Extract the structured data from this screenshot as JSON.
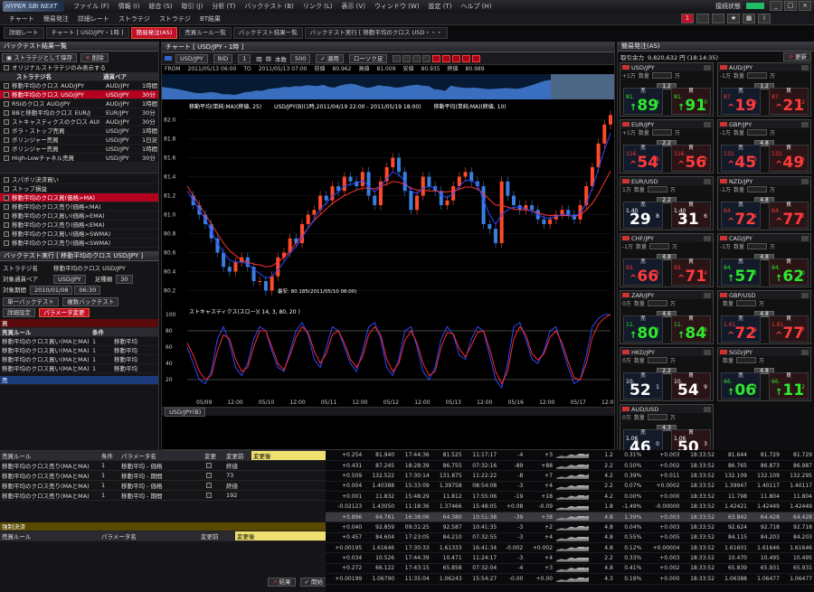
{
  "app": {
    "logo_text": "HYPER SBI NEXT",
    "menu": [
      "ファイル (F)",
      "情報 (I)",
      "総合 (S)",
      "取引 (J)",
      "分析 (T)",
      "バックテスト (B)",
      "リンク (L)",
      "表示 (V)",
      "ウィンドウ (W)",
      "設定 (T)",
      "ヘルプ (H)"
    ],
    "status_label": "接続状態",
    "page_number": "1"
  },
  "toolbar": [
    "チャート",
    "簡易発注",
    "詳細レート",
    "ストラテジ",
    "ストラテジ",
    "BT結果"
  ],
  "tabs": [
    {
      "label": "詳細レート",
      "active": false
    },
    {
      "label": "チャート [ USD/JPY・1時 ]",
      "active": false
    },
    {
      "label": "簡易発注(AS)",
      "active": true
    },
    {
      "label": "売買ルール一覧",
      "active": false
    },
    {
      "label": "バックテスト結果一覧",
      "active": false
    },
    {
      "label": "バックテスト実行 [ 移動平均のクロス USD・・・",
      "active": false
    }
  ],
  "left": {
    "title": "バックテスト結果一覧",
    "save_btn": "ストラテジとして保存",
    "delete_btn": "削除",
    "only_original": "オリジナルストラテジのみ表示する",
    "headers": [
      "ストラテジ名",
      "通貨ペア",
      ""
    ],
    "results": [
      {
        "name": "移動平均のクロス AUD/JPY",
        "pair": "AUD/JPY",
        "tf": "1時間",
        "sel": false
      },
      {
        "name": "移動平均のクロス USD/JPY",
        "pair": "USD/JPY",
        "tf": "30分",
        "sel": true
      },
      {
        "name": "RSIのクロス AUD/JPY",
        "pair": "AUD/JPY",
        "tf": "1時間",
        "sel": false
      },
      {
        "name": "BBと移動平均のクロス EUR/J",
        "pair": "EUR/JPY",
        "tf": "30分",
        "sel": false
      },
      {
        "name": "ストキャスティクスのクロス AUI",
        "pair": "AUD/JPY",
        "tf": "30分",
        "sel": false
      },
      {
        "name": "ボラ・ストップ売買",
        "pair": "USD/JPY",
        "tf": "1時間",
        "sel": false
      },
      {
        "name": "ボリンジャー売買",
        "pair": "USD/JPY",
        "tf": "1日足",
        "sel": false
      },
      {
        "name": "ボリンジャー売買",
        "pair": "USD/JPY",
        "tf": "1時間",
        "sel": false
      },
      {
        "name": "High-Lowチャネル売買",
        "pair": "USD/JPY",
        "tf": "30分",
        "sel": false
      }
    ],
    "rules": [
      {
        "name": "スパボリ決済買い",
        "sel": false
      },
      {
        "name": "ストップ損益",
        "sel": false
      },
      {
        "name": "移動平均のクロス買(価格>MA)",
        "sel": true
      },
      {
        "name": "移動平均のクロス売り(価格<MA)",
        "sel": false
      },
      {
        "name": "移動平均のクロス買い(価格>EMA)",
        "sel": false
      },
      {
        "name": "移動平均のクロス売り(価格<EMA)",
        "sel": false
      },
      {
        "name": "移動平均のクロス買い(価格>SWMA)",
        "sel": false
      },
      {
        "name": "移動平均のクロス売り(価格<SWMA)",
        "sel": false
      }
    ],
    "exec_title": "バックテスト実行 [ 移動平均のクロス USD/JPY ]",
    "strategy_label": "ストラテジ名",
    "strategy_value": "移動平均のクロス USD/JPY",
    "pair_label": "対象通貨ペア",
    "pair_value": "USD/JPY",
    "tf_label": "足種類",
    "tf_value": "30",
    "period_label": "対象期間",
    "date_from": "2010/01/08",
    "time_from": "06:30",
    "single_tab": "単一バックテスト",
    "multi_tab": "複数バックテスト",
    "detail_tab": "詳細設定",
    "param_tab": "パラメータ変更",
    "buy_label": "買",
    "rule_headers": [
      "売買ルール",
      "条件",
      ""
    ],
    "buy_rules": [
      {
        "rule": "移動平均のクロス買い(MAとMA)",
        "cond": "1",
        "name": "移動平均"
      },
      {
        "rule": "移動平均のクロス買い(MAとMA)",
        "cond": "1",
        "name": "移動平均"
      },
      {
        "rule": "移動平均のクロス買い(MAとMA)",
        "cond": "1",
        "name": "移動平均"
      },
      {
        "rule": "移動平均のクロス買い(MAとMA)",
        "cond": "1",
        "name": "移動平均"
      }
    ],
    "sell_label": "売"
  },
  "bottomleft": {
    "headers": [
      "売買ルール",
      "条件",
      "パラメータ名",
      "変更",
      "変更前",
      "変更後"
    ],
    "rows": [
      {
        "rule": "移動平均のクロス売り(MAとMA)",
        "cond": "1",
        "param": "移動平均 - 価格",
        "before": "終値"
      },
      {
        "rule": "移動平均のクロス売り(MAとMA)",
        "cond": "1",
        "param": "移動平均 - 期間",
        "before": "73"
      },
      {
        "rule": "移動平均のクロス売り(MAとMA)",
        "cond": "1",
        "param": "移動平均 - 価格",
        "before": "終値"
      },
      {
        "rule": "移動平均のクロス売り(MAとMA)",
        "cond": "1",
        "param": "移動平均 - 期間",
        "before": "192"
      }
    ],
    "forced_label": "強制決済",
    "forced_headers": [
      "売買ルール",
      "パラメータ名",
      "変更前",
      "変更後"
    ],
    "result_btn": "結果",
    "start_btn": "開始"
  },
  "chart": {
    "title": "チャート [ USD/JPY・1時 ]",
    "pair": "USD/JPY",
    "bid": "BID",
    "tf": "1",
    "tf_unit": "時",
    "count_label": "本数",
    "count": "500",
    "apply": "適用",
    "candle": "ローソク足",
    "from_label": "FROM",
    "from": "2011/05/13 06:00",
    "to_label": "TO",
    "to": "2011/05/13 07:00",
    "open_label": "前値",
    "open": "80.962",
    "high_label": "高値",
    "high": "81.009",
    "low_label": "安値",
    "low": "80.935",
    "close_label": "終値",
    "close": "80.989",
    "ma_legend1": "移動平均(単純:MA)(終値, 25)",
    "series_legend": "USD/JPY(B)(1時,2011/04/19 22:00 - 2011/05/19 18:00)",
    "ma_legend2": "移動平均(単純:MA)(終値, 10)",
    "low_marker": "最安: 80.185(2011/05/10 08:00)",
    "stoch_legend": "ストキャスティクス(スロー)( 14, 3, 80, 20 )",
    "footer_tab": "USD/JPY(B)"
  },
  "chart_data": {
    "type": "line",
    "title": "USD/JPY 1時",
    "y_ticks": [
      82.0,
      81.8,
      81.6,
      81.4,
      81.2,
      81.0,
      80.8,
      80.6,
      80.4,
      80.2
    ],
    "ylim": [
      80.1,
      82.1
    ],
    "x_ticks": [
      "05/09",
      "12:00",
      "05/10",
      "12:00",
      "05/11",
      "12:00",
      "05/12",
      "12:00",
      "05/13",
      "12:00",
      "05/16",
      "12:00",
      "05/17",
      "12:00"
    ],
    "price": [
      81.2,
      81.1,
      81.0,
      80.9,
      80.75,
      80.6,
      80.45,
      80.4,
      80.5,
      80.55,
      80.45,
      80.3,
      80.3,
      80.2,
      80.35,
      80.55,
      80.6,
      80.75,
      80.7,
      80.9,
      81.0,
      81.05,
      81.2,
      81.15,
      81.3,
      81.25,
      81.4,
      81.35,
      81.3,
      81.45,
      81.2,
      81.1,
      81.35,
      81.5,
      81.6,
      81.45,
      81.25,
      81.05,
      81.2,
      81.4,
      81.3,
      81.25,
      81.1,
      81.15,
      81.3,
      81.4,
      81.45,
      81.35,
      81.3,
      80.9,
      80.85,
      80.7,
      81.35,
      81.2,
      81.1,
      81.05,
      81.1,
      81.05,
      80.95,
      80.9,
      80.95,
      81.0,
      81.05,
      81.0,
      80.95,
      81.1,
      81.3,
      81.5,
      81.75,
      81.95,
      82.05
    ],
    "ma25": [
      81.3,
      81.2,
      81.1,
      81.0,
      80.9,
      80.8,
      80.7,
      80.62,
      80.57,
      80.52,
      80.5,
      80.48,
      80.47,
      80.45,
      80.46,
      80.5,
      80.55,
      80.62,
      80.7,
      80.78,
      80.86,
      80.94,
      81.0,
      81.06,
      81.12,
      81.16,
      81.2,
      81.23,
      81.26,
      81.28,
      81.28,
      81.27,
      81.3,
      81.32,
      81.35,
      81.34,
      81.32,
      81.28,
      81.26,
      81.26,
      81.25,
      81.25,
      81.24,
      81.24,
      81.25,
      81.27,
      81.29,
      81.29,
      81.27,
      81.22,
      81.16,
      81.1,
      81.1,
      81.08,
      81.06,
      81.05,
      81.05,
      81.04,
      81.02,
      81.0,
      80.99,
      80.99,
      80.99,
      80.99,
      80.98,
      81.0,
      81.05,
      81.12,
      81.22,
      81.34,
      81.46
    ],
    "ma10": [
      81.25,
      81.15,
      81.05,
      80.95,
      80.82,
      80.7,
      80.6,
      80.52,
      80.5,
      80.5,
      80.48,
      80.42,
      80.38,
      80.33,
      80.35,
      80.42,
      80.5,
      80.6,
      80.66,
      80.76,
      80.86,
      80.95,
      81.06,
      81.12,
      81.2,
      81.24,
      81.3,
      81.32,
      81.33,
      81.36,
      81.3,
      81.24,
      81.3,
      81.38,
      81.45,
      81.42,
      81.35,
      81.25,
      81.22,
      81.28,
      81.3,
      81.28,
      81.2,
      81.18,
      81.22,
      81.3,
      81.36,
      81.36,
      81.32,
      81.15,
      81.0,
      80.9,
      81.0,
      81.05,
      81.08,
      81.08,
      81.06,
      81.04,
      81.0,
      80.97,
      80.96,
      80.98,
      81.0,
      81.0,
      80.98,
      81.02,
      81.12,
      81.28,
      81.48,
      81.68,
      81.86
    ],
    "stoch_k": [
      60,
      40,
      20,
      15,
      30,
      70,
      85,
      65,
      35,
      25,
      40,
      70,
      85,
      80,
      55,
      35,
      30,
      55,
      80,
      90,
      75,
      45,
      35,
      60,
      85,
      80,
      60,
      40,
      30,
      55,
      85,
      90,
      70,
      35,
      25,
      45,
      80,
      85,
      60,
      30,
      20,
      35,
      70,
      85,
      75,
      50,
      45,
      70,
      85,
      80,
      50,
      20,
      10,
      40,
      85,
      90,
      70,
      45,
      40,
      55,
      80,
      85,
      60,
      35,
      15,
      20,
      50,
      85,
      95,
      100,
      100
    ],
    "stoch_d": [
      65,
      50,
      30,
      20,
      25,
      55,
      75,
      70,
      45,
      30,
      35,
      60,
      80,
      80,
      60,
      40,
      32,
      50,
      72,
      85,
      78,
      55,
      40,
      52,
      75,
      80,
      65,
      45,
      35,
      48,
      75,
      85,
      75,
      45,
      30,
      40,
      68,
      80,
      65,
      40,
      25,
      30,
      60,
      78,
      76,
      58,
      48,
      62,
      78,
      80,
      58,
      30,
      15,
      30,
      70,
      85,
      75,
      52,
      44,
      52,
      72,
      80,
      65,
      42,
      22,
      20,
      40,
      72,
      88,
      96,
      100
    ],
    "stoch_ylim": [
      0,
      100
    ],
    "stoch_lines": [
      80,
      20
    ]
  },
  "right": {
    "title": "簡易発注(AS)",
    "balance_label": "取引余力",
    "balance": "9,820,632 円 (18:14:35)",
    "refresh": "更新",
    "qty_label": "数量",
    "unit": "万",
    "sell": "売",
    "buy": "買",
    "quotes": [
      {
        "pair": "USD/JPY",
        "step": "+1万",
        "spread": "1.2",
        "sell_sm": "81.",
        "sell_big": "89",
        "sell_sup": "8",
        "buy_sm": "81.",
        "buy_big": "91",
        "buy_sup": "0",
        "dir_s": "up",
        "dir_b": "up",
        "arrow_s": "↑",
        "arrow_b": "↑"
      },
      {
        "pair": "AUD/JPY",
        "step": "-1万",
        "spread": "1.2",
        "sell_sm": "87.",
        "sell_big": "19",
        "sell_sup": "6",
        "buy_sm": "87.",
        "buy_big": "21",
        "buy_sup": "2",
        "dir_s": "dn",
        "dir_b": "dn",
        "arrow_s": "^",
        "arrow_b": "^"
      },
      {
        "pair": "EUR/JPY",
        "step": "+1万",
        "spread": "2.2",
        "sell_sm": "116.",
        "sell_big": "54",
        "sell_sup": "6",
        "buy_sm": "116.",
        "buy_big": "56",
        "buy_sup": "8",
        "dir_s": "dn",
        "dir_b": "dn",
        "arrow_s": "^",
        "arrow_b": "^"
      },
      {
        "pair": "GBP/JPY",
        "step": "-1万",
        "spread": "4.8",
        "sell_sm": "132.",
        "sell_big": "45",
        "sell_sup": "8",
        "buy_sm": "132.",
        "buy_big": "49",
        "buy_sup": "6",
        "dir_s": "dn",
        "dir_b": "dn",
        "arrow_s": "^",
        "arrow_b": "^"
      },
      {
        "pair": "EUR/USD",
        "step": "1万",
        "spread": "2.2",
        "sell_sm": "1.40",
        "sell_big": "29",
        "sell_sup": "8",
        "buy_sm": "1.40",
        "buy_big": "31",
        "buy_sup": "6",
        "dir_s": "wh",
        "dir_b": "wh",
        "arrow_s": "",
        "arrow_b": ""
      },
      {
        "pair": "NZD/JPY",
        "step": "-1万",
        "spread": "4.8",
        "sell_sm": "64.",
        "sell_big": "72",
        "sell_sup": "4",
        "buy_sm": "64.",
        "buy_big": "77",
        "buy_sup": "2",
        "dir_s": "dn",
        "dir_b": "dn",
        "arrow_s": "^",
        "arrow_b": "^"
      },
      {
        "pair": "CHF/JPY",
        "step": "-1万",
        "spread": "4.8",
        "sell_sm": "92.",
        "sell_big": "66",
        "sell_sup": "6",
        "buy_sm": "92.",
        "buy_big": "71",
        "buy_sup": "4",
        "dir_s": "dn",
        "dir_b": "dn",
        "arrow_s": "^",
        "arrow_b": "^"
      },
      {
        "pair": "CAD/JPY",
        "step": "-1万",
        "spread": "4.8",
        "sell_sm": "84.",
        "sell_big": "57",
        "sell_sup": "2",
        "buy_sm": "84.",
        "buy_big": "62",
        "buy_sup": "0",
        "dir_s": "up",
        "dir_b": "up",
        "arrow_s": "↑",
        "arrow_b": "↑"
      },
      {
        "pair": "ZAR/JPY",
        "step": "0万",
        "spread": "4.6",
        "sell_sm": "11.",
        "sell_big": "80",
        "sell_sup": "2",
        "buy_sm": "11.",
        "buy_big": "84",
        "buy_sup": "8",
        "dir_s": "up",
        "dir_b": "up",
        "arrow_s": "↑",
        "arrow_b": "↑"
      },
      {
        "pair": "GBP/USD",
        "step": "",
        "spread": "4.8",
        "sell_sm": "1.61",
        "sell_big": "72",
        "sell_sup": "9",
        "buy_sm": "1.61",
        "buy_big": "77",
        "buy_sup": "7",
        "dir_s": "dn",
        "dir_b": "dn",
        "arrow_s": "^",
        "arrow_b": "^"
      },
      {
        "pair": "HKD/JPY",
        "step": "0万",
        "spread": "2.2",
        "sell_sm": "10.",
        "sell_big": "52",
        "sell_sup": "1",
        "buy_sm": "10.",
        "buy_big": "54",
        "buy_sup": "9",
        "dir_s": "wh",
        "dir_b": "wh",
        "arrow_s": "",
        "arrow_b": ""
      },
      {
        "pair": "SGD/JPY",
        "step": "",
        "spread": "4.8",
        "sell_sm": "66.",
        "sell_big": "06",
        "sell_sup": "4",
        "buy_sm": "66.",
        "buy_big": "11",
        "buy_sup": "2",
        "dir_s": "up",
        "dir_b": "up",
        "arrow_s": "↑",
        "arrow_b": "↑"
      },
      {
        "pair": "AUD/USD",
        "step": "0万",
        "spread": "4.3",
        "sell_sm": "1.06",
        "sell_big": "46",
        "sell_sup": "0",
        "buy_sm": "1.06",
        "buy_big": "50",
        "buy_sup": "3",
        "dir_s": "wh",
        "dir_b": "wh",
        "arrow_s": "",
        "arrow_b": ""
      }
    ]
  },
  "ticker": [
    [
      "+0.254",
      "81.940",
      "17:44:36",
      "81.525",
      "11:17:17",
      "-4",
      "+3",
      "1.2",
      "0.31%",
      "+0.003",
      "18:33:52",
      "81.644",
      "81.729",
      "81.729"
    ],
    [
      "+0.431",
      "87.245",
      "18:28:39",
      "86.755",
      "07:32:16",
      "-89",
      "+88",
      "2.2",
      "0.50%",
      "+0.002",
      "18:33:52",
      "86.765",
      "86.873",
      "86.987"
    ],
    [
      "+0.509",
      "132.522",
      "17:30:14",
      "131.875",
      "11:22:22",
      "-8",
      "+7",
      "4.2",
      "0.39%",
      "+0.011",
      "18:33:52",
      "132.109",
      "132.109",
      "132.295"
    ],
    [
      "+0.004",
      "1.40388",
      "15:33:09",
      "1.39758",
      "08:54:08",
      "-3",
      "+4",
      "2.2",
      "0.07%",
      "+0.0002",
      "18:33:52",
      "1.39947",
      "1.40117",
      "1.40117"
    ],
    [
      "+0.001",
      "11.832",
      "15:48:29",
      "11.812",
      "17:55:06",
      "-19",
      "+18",
      "4.2",
      "0.00%",
      "+0.000",
      "18:33:52",
      "11.798",
      "11.804",
      "11.804"
    ],
    [
      "-0.02123",
      "1.43050",
      "11:18:36",
      "1.37466",
      "15:48:05",
      "+0.08",
      "-0.09",
      "1.8",
      "-1.49%",
      "-0.00000",
      "18:33:52",
      "1.42421",
      "1.42449",
      "1.42449"
    ],
    [
      "+0.896",
      "64.761",
      "16:38:06",
      "64.380",
      "10:51:38",
      "-39",
      "+38",
      "4.8",
      "1.39%",
      "+0.003",
      "18:33:52",
      "63.842",
      "64.428",
      "64.428"
    ],
    [
      "+0.040",
      "92.859",
      "09:31:25",
      "92.587",
      "10:41:35",
      "-3",
      "+2",
      "4.8",
      "0.04%",
      "+0.003",
      "18:33:52",
      "92.624",
      "92.718",
      "92.718"
    ],
    [
      "+0.457",
      "84.604",
      "17:23:05",
      "84.210",
      "07:32:55",
      "-3",
      "+4",
      "4.8",
      "0.55%",
      "+0.005",
      "18:33:52",
      "84.115",
      "84.203",
      "84.203"
    ],
    [
      "+0.00195",
      "1.61646",
      "17:30:33",
      "1.61333",
      "16:41:34",
      "-0.002",
      "+0.002",
      "4.8",
      "0.12%",
      "+0.00004",
      "18:33:52",
      "1.61601",
      "1.61646",
      "1.61646"
    ],
    [
      "+0.034",
      "10.526",
      "17:44:39",
      "10.471",
      "11:24:17",
      "-3",
      "+4",
      "2.2",
      "0.33%",
      "+0.003",
      "18:33:52",
      "10.470",
      "10.495",
      "10.495"
    ],
    [
      "+0.272",
      "66.122",
      "17:43:15",
      "65.858",
      "07:32:04",
      "-4",
      "+3",
      "4.8",
      "0.41%",
      "+0.002",
      "18:33:52",
      "65.839",
      "65.931",
      "65.931"
    ],
    [
      "+0.00199",
      "1.06790",
      "11:35:04",
      "1.06243",
      "15:54:27",
      "-0.00",
      "+0.00",
      "4.3",
      "0.19%",
      "+0.000",
      "18:33:52",
      "1.06388",
      "1.06477",
      "1.06477"
    ]
  ],
  "colors": {
    "accent": "#c0102a",
    "up": "#2ee82e",
    "down": "#ff3b3b",
    "ma25": "#ff3333",
    "ma10": "#2e49ff"
  }
}
